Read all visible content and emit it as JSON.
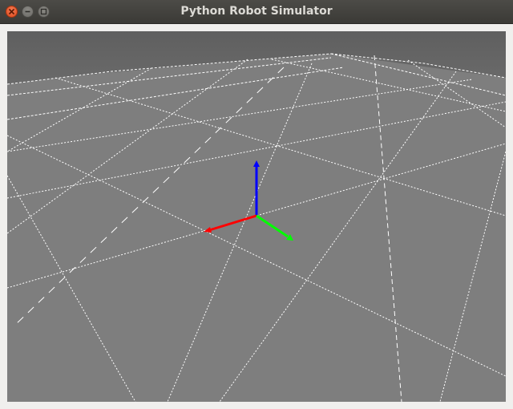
{
  "window": {
    "title": "Python Robot Simulator",
    "close_icon": "close-icon",
    "minimize_icon": "minimize-icon",
    "maximize_icon": "maximize-icon"
  },
  "scene": {
    "sky_color": "#676767",
    "floor_color": "#7e7e7e",
    "grid_color": "#ffffff",
    "axes": {
      "x_color": "#ff0000",
      "y_color": "#00ff00",
      "z_color": "#0000ff"
    }
  }
}
